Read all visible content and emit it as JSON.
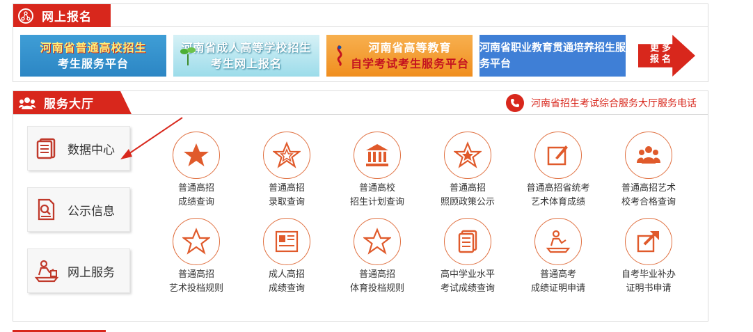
{
  "online_registration": {
    "title": "网上报名",
    "banners": [
      {
        "line1": "河南省普通高校招生",
        "line2": "考生服务平台"
      },
      {
        "line1": "河南省成人高等学校招生",
        "line2": "考生网上报名"
      },
      {
        "line1": "河南省高等教育",
        "line2": "自学考试考生服务平台"
      },
      {
        "line1": "河南省职业教育贯通培养招生服务平台"
      }
    ],
    "more": "更多报名"
  },
  "service_hall": {
    "title": "服务大厅",
    "hotline_label": "河南省招生考试综合服务大厅服务电话",
    "side_buttons": [
      {
        "label": "数据中心",
        "icon": "document-stack-icon"
      },
      {
        "label": "公示信息",
        "icon": "document-search-icon"
      },
      {
        "label": "网上服务",
        "icon": "person-at-desk-icon"
      }
    ],
    "services": [
      {
        "line1": "普通高招",
        "line2": "成绩查询",
        "icon": "star-filled-icon"
      },
      {
        "line1": "普通高招",
        "line2": "录取查询",
        "icon": "star-outline-icon"
      },
      {
        "line1": "普通高校",
        "line2": "招生计划查询",
        "icon": "institution-icon"
      },
      {
        "line1": "普通高招",
        "line2": "照顾政策公示",
        "icon": "star-badge-icon"
      },
      {
        "line1": "普通高招省统考",
        "line2": "艺术体育成绩",
        "icon": "edit-icon"
      },
      {
        "line1": "普通高招艺术",
        "line2": "校考合格查询",
        "icon": "group-icon"
      },
      {
        "line1": "普通高招",
        "line2": "艺术投档规则",
        "icon": "star-outline-icon"
      },
      {
        "line1": "成人高招",
        "line2": "成绩查询",
        "icon": "certificate-icon"
      },
      {
        "line1": "普通高招",
        "line2": "体育投档规则",
        "icon": "star-outline-icon"
      },
      {
        "line1": "高中学业水平",
        "line2": "考试成绩查询",
        "icon": "document-stack-icon"
      },
      {
        "line1": "普通高考",
        "line2": "成绩证明申请",
        "icon": "person-at-desk-icon"
      },
      {
        "line1": "自考毕业补办",
        "line2": "证明书申请",
        "icon": "share-arrow-icon"
      }
    ]
  },
  "colors": {
    "brand_red": "#d8271c",
    "icon_orange": "#e05a2b"
  }
}
